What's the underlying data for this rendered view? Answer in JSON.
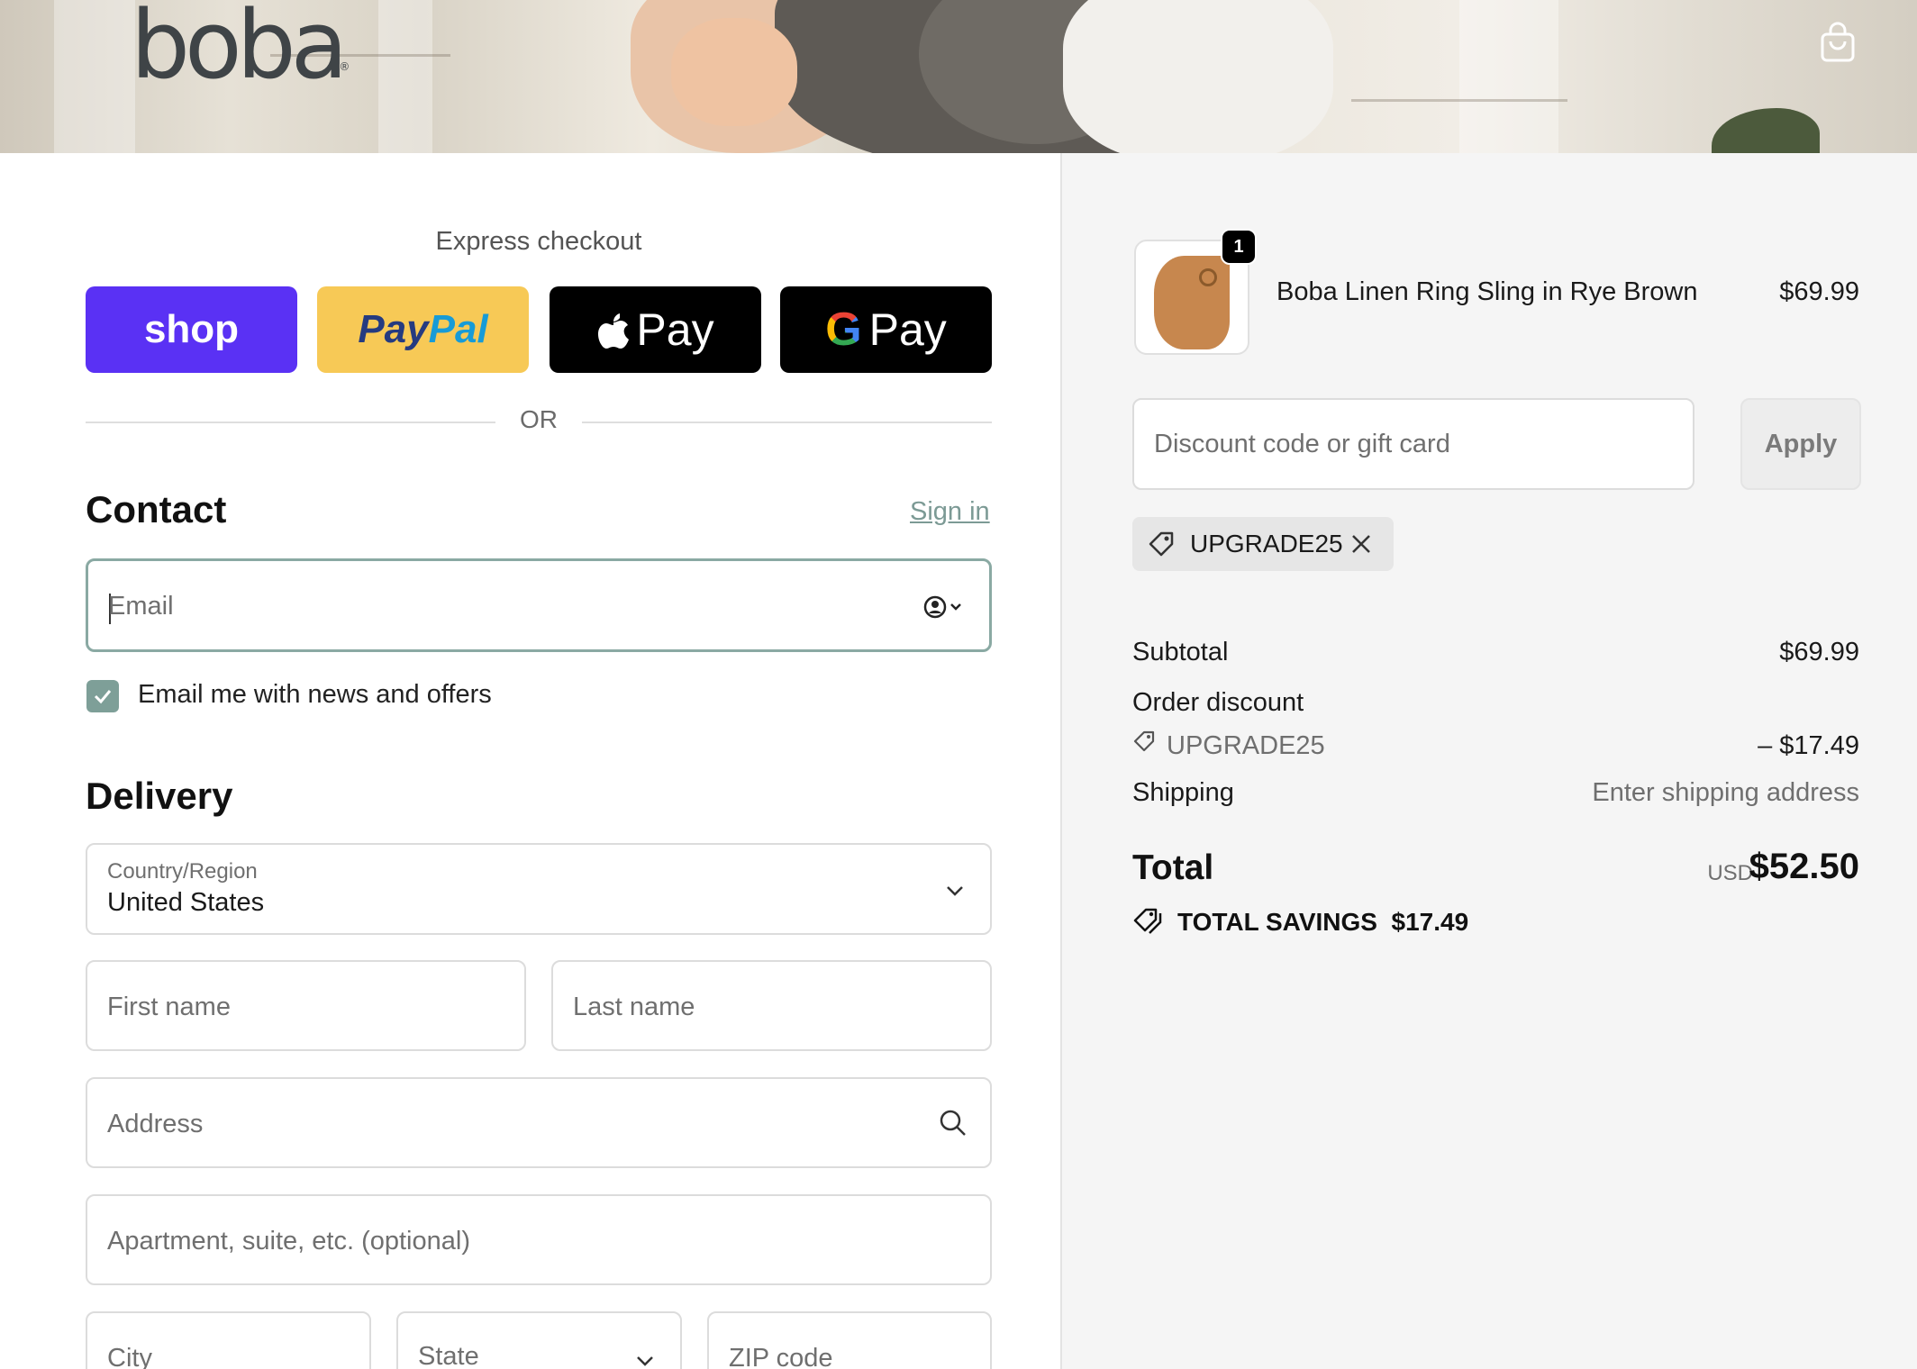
{
  "header": {
    "logo_text": "boba",
    "cart_icon": "shopping-bag-icon"
  },
  "express": {
    "title": "Express checkout",
    "shop_label": "shop",
    "paypal_label_1": "Pay",
    "paypal_label_2": "Pal",
    "apple_pay_label": "Pay",
    "google_pay_letter": "G",
    "google_pay_label": "Pay",
    "or_label": "OR"
  },
  "contact": {
    "heading": "Contact",
    "sign_in": "Sign in",
    "email_placeholder": "Email",
    "newsletter_label": "Email me with news and offers",
    "newsletter_checked": true
  },
  "delivery": {
    "heading": "Delivery",
    "country_label": "Country/Region",
    "country_value": "United States",
    "first_name_placeholder": "First name",
    "last_name_placeholder": "Last name",
    "address_placeholder": "Address",
    "apartment_placeholder": "Apartment, suite, etc. (optional)",
    "city_placeholder": "City",
    "state_placeholder": "State",
    "zip_placeholder": "ZIP code"
  },
  "order": {
    "item": {
      "name": "Boba Linen Ring Sling in Rye Brown",
      "price": "$69.99",
      "quantity": "1"
    },
    "discount_placeholder": "Discount code or gift card",
    "apply_label": "Apply",
    "applied_code": "UPGRADE25",
    "subtotal_label": "Subtotal",
    "subtotal_value": "$69.99",
    "order_discount_label": "Order discount",
    "discount_code": "UPGRADE25",
    "discount_value": "– $17.49",
    "shipping_label": "Shipping",
    "shipping_value": "Enter shipping address",
    "total_label": "Total",
    "total_currency": "USD",
    "total_value": "$52.50",
    "savings_label": "TOTAL SAVINGS",
    "savings_value": "$17.49"
  },
  "colors": {
    "shop_purple": "#5a31f4",
    "paypal_yellow": "#f7c956",
    "accent_green": "#7e9f98"
  }
}
